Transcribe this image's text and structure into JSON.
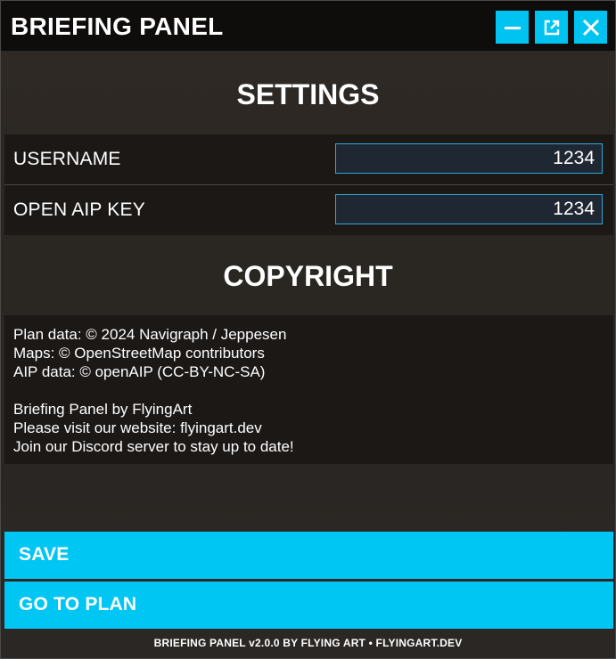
{
  "window": {
    "title": "BRIEFING PANEL",
    "controls": {
      "minimize_icon": "minimize-icon",
      "popout_icon": "popout-icon",
      "close_icon": "close-icon"
    }
  },
  "settings": {
    "heading": "SETTINGS",
    "fields": [
      {
        "label": "USERNAME",
        "value": "1234"
      },
      {
        "label": "OPEN AIP KEY",
        "value": "1234"
      }
    ]
  },
  "copyright": {
    "heading": "COPYRIGHT",
    "lines": [
      "Plan data: © 2024 Navigraph / Jeppesen",
      "Maps: © OpenStreetMap contributors",
      "AIP data: © openAIP (CC-BY-NC-SA)",
      "Briefing Panel by FlyingArt",
      "Please visit our website: flyingart.dev",
      "Join our Discord server to stay up to date!"
    ]
  },
  "actions": {
    "save_label": "SAVE",
    "go_to_plan_label": "GO TO PLAN"
  },
  "footer": {
    "text": "BRIEFING PANEL v2.0.0 BY FLYING ART • FLYINGART.DEV"
  },
  "colors": {
    "accent": "#00c6f3",
    "panel_bg": "#1b1816",
    "window_bg": "#2b2724",
    "titlebar_bg": "#0e0d0c",
    "input_bg": "#1f2733",
    "input_border": "#2fa8d8"
  }
}
